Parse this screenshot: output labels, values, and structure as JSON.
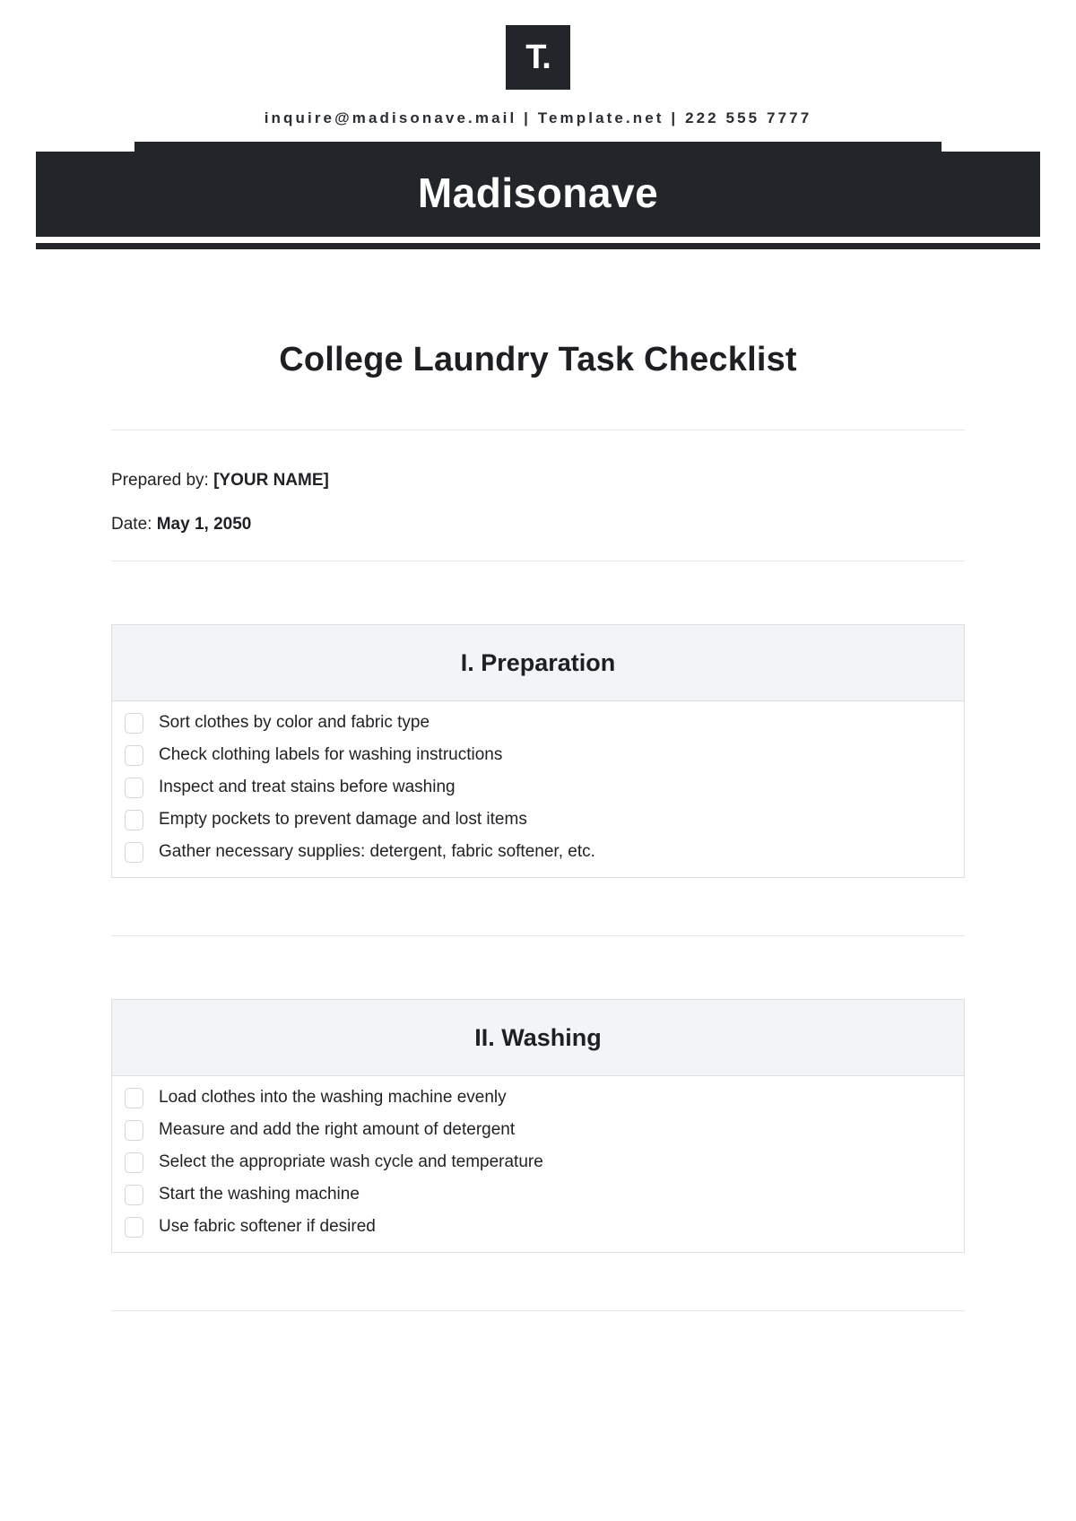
{
  "letterhead": {
    "logo_text": "T.",
    "logo_icon": "template-net-logo-icon",
    "contact": "inquire@madisonave.mail | Template.net | 222 555 7777"
  },
  "banner": {
    "company": "Madisonave",
    "background_color": "#22252a",
    "text_color": "#ffffff"
  },
  "document": {
    "title": "College Laundry Task Checklist",
    "prepared_by_label": "Prepared by:",
    "prepared_by_value": "[YOUR NAME]",
    "date_label": "Date:",
    "date_value": "May 1, 2050"
  },
  "sections": [
    {
      "heading": "I. Preparation",
      "items": [
        "Sort clothes by color and fabric type",
        "Check clothing labels for washing instructions",
        "Inspect and treat stains before washing",
        "Empty pockets to prevent damage and lost items",
        "Gather necessary supplies: detergent, fabric softener, etc."
      ]
    },
    {
      "heading": "II. Washing",
      "items": [
        "Load clothes into the washing machine evenly",
        "Measure and add the right amount of detergent",
        "Select the appropriate wash cycle and temperature",
        "Start the washing machine",
        "Use fabric softener if desired"
      ]
    }
  ],
  "theme": {
    "header_bg": "#f2f4f8",
    "border_color": "#dcdee3",
    "divider_color": "#e6e7ea",
    "text_color": "#1f2124"
  }
}
